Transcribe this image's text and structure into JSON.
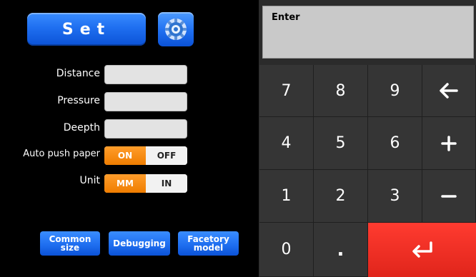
{
  "left": {
    "set_label": "Set",
    "gear_icon": "gear-icon",
    "rows": {
      "distance": "Distance",
      "pressure": "Pressure",
      "deepth": "Deepth",
      "auto_push_paper": "Auto push paper",
      "unit": "Unit"
    },
    "auto_push_toggle": {
      "on": "ON",
      "off": "OFF",
      "selected": "ON"
    },
    "unit_toggle": {
      "mm": "MM",
      "in": "IN",
      "selected": "MM"
    },
    "bottom_buttons": {
      "common_size": [
        "Common",
        "size"
      ],
      "debugging": "Debugging",
      "factory_model": [
        "Facetory",
        "model"
      ]
    }
  },
  "right": {
    "display_title": "Enter",
    "keys": {
      "k7": "7",
      "k8": "8",
      "k9": "9",
      "k4": "4",
      "k5": "5",
      "k6": "6",
      "k1": "1",
      "k2": "2",
      "k3": "3",
      "k0": "0",
      "dot": "."
    },
    "icons": {
      "backspace": "arrow-left-icon",
      "plus": "plus-icon",
      "minus": "minus-icon",
      "enter": "enter-icon"
    }
  },
  "colors": {
    "button_blue": "#1f6ff0",
    "toggle_orange": "#ef7d00",
    "enter_red": "#e0251b",
    "keypad_bg": "#353535"
  }
}
